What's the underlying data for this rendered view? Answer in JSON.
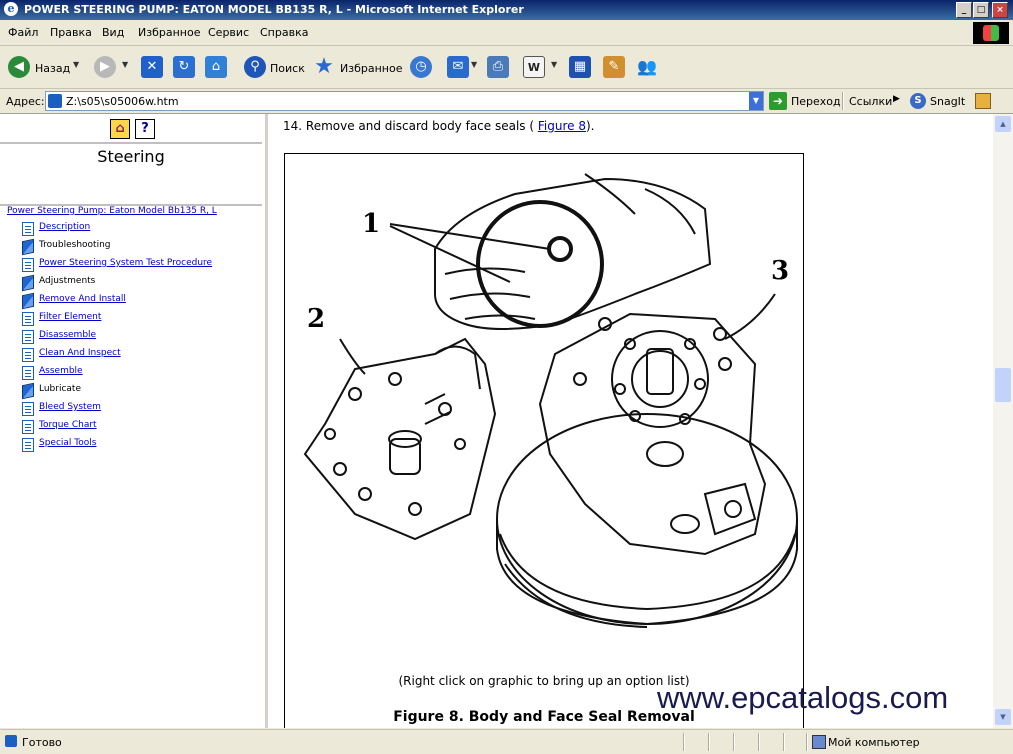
{
  "window": {
    "title": "POWER STEERING PUMP: EATON MODEL BB135 R, L - Microsoft Internet Explorer"
  },
  "menu": [
    "Файл",
    "Правка",
    "Вид",
    "Избранное",
    "Сервис",
    "Справка"
  ],
  "toolbar": {
    "back_label": "Назад",
    "search_label": "Поиск",
    "favorites_label": "Избранное"
  },
  "address": {
    "label": "Адрес:",
    "value": "Z:\\s05\\s05006w.htm",
    "go_label": "Переход",
    "links_label": "Ссылки",
    "snagit_label": "SnagIt"
  },
  "sidebar": {
    "heading": "Steering",
    "root_link": "Power Steering Pump: Eaton Model Bb135 R, L",
    "items": [
      {
        "label": "Description",
        "icon": "page",
        "link": true
      },
      {
        "label": "Troubleshooting",
        "icon": "book",
        "link": false
      },
      {
        "label": "Power Steering System Test Procedure",
        "icon": "page",
        "link": true
      },
      {
        "label": "Adjustments",
        "icon": "book",
        "link": false
      },
      {
        "label": "Remove And Install",
        "icon": "book",
        "link": true
      },
      {
        "label": "Filter Element",
        "icon": "page",
        "link": true
      },
      {
        "label": "Disassemble",
        "icon": "page",
        "link": true
      },
      {
        "label": "Clean And Inspect",
        "icon": "page",
        "link": true
      },
      {
        "label": "Assemble",
        "icon": "page",
        "link": true
      },
      {
        "label": "Lubricate",
        "icon": "book",
        "link": false
      },
      {
        "label": "Bleed System",
        "icon": "page",
        "link": true
      },
      {
        "label": "Torque Chart",
        "icon": "page",
        "link": true
      },
      {
        "label": "Special Tools",
        "icon": "page",
        "link": true
      }
    ]
  },
  "content": {
    "step_text": "14. Remove and discard body face seals (",
    "figure_link": "Figure 8",
    "step_end": ").",
    "callouts": [
      "1",
      "2",
      "3"
    ],
    "hint": "(Right click on graphic to bring up an option list)",
    "figure_title": "Figure 8. Body and Face Seal Removal",
    "watermark": "www.epcatalogs.com"
  },
  "status": {
    "text": "Готово",
    "zone": "Мой компьютер"
  }
}
